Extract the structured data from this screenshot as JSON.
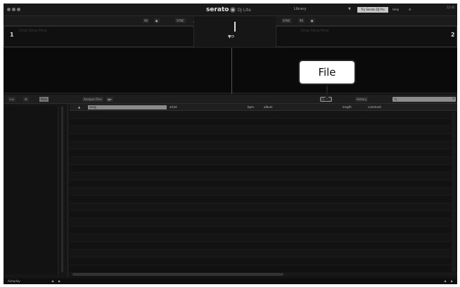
{
  "app": {
    "logo_text": "serato",
    "logo_sub": "DJ Lite",
    "center_label": "Library",
    "mode_label": "Try Serato DJ Pro",
    "mode_extra": "Help",
    "clock": "12:45"
  },
  "decks": {
    "left": {
      "number": "1",
      "placeholder": "Drop Song Here",
      "btn_a": "96",
      "btn_b": "●",
      "btn_c": "SYNC"
    },
    "right": {
      "number": "2",
      "placeholder": "Drop Song Here",
      "btn_a": "SYNC",
      "btn_b": "96",
      "btn_c": "●"
    }
  },
  "library_toolbar": {
    "view_label": "Files",
    "analyze_label": "Analyze Files",
    "history_label": "History",
    "search_placeholder": "Q"
  },
  "callout": {
    "label": "File"
  },
  "columns": [
    {
      "key": "song",
      "label": "song"
    },
    {
      "key": "artist",
      "label": "artist"
    },
    {
      "key": "bpm",
      "label": "bpm"
    },
    {
      "key": "album",
      "label": "album"
    },
    {
      "key": "length",
      "label": "length"
    },
    {
      "key": "comment",
      "label": "comment"
    }
  ],
  "status": {
    "left_label": "Autoplay"
  }
}
